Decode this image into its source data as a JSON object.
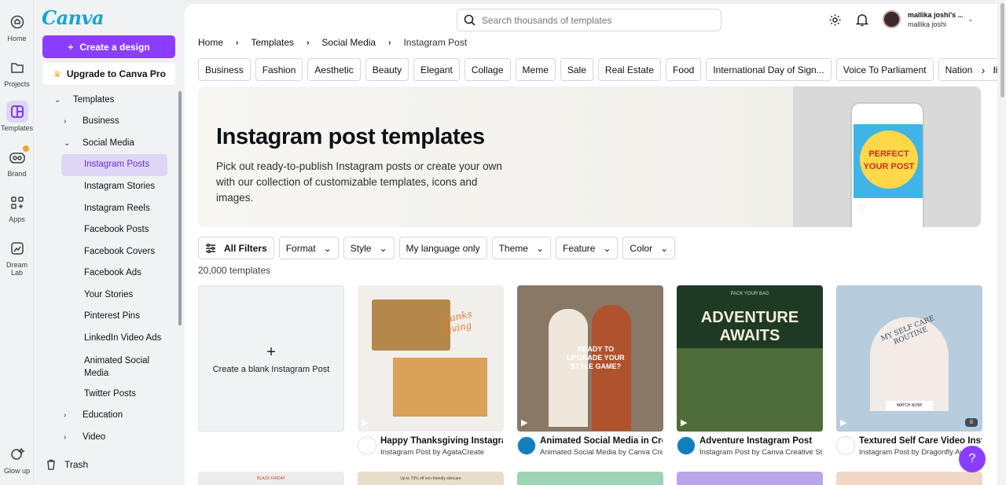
{
  "rail": [
    {
      "label": "Home",
      "icon": "home-icon"
    },
    {
      "label": "Projects",
      "icon": "folder-icon"
    },
    {
      "label": "Templates",
      "icon": "templates-icon"
    },
    {
      "label": "Brand",
      "icon": "brand-icon"
    },
    {
      "label": "Apps",
      "icon": "apps-icon"
    },
    {
      "label": "Dream Lab",
      "icon": "dream-lab-icon"
    },
    {
      "label": "Glow up",
      "icon": "glow-up-icon"
    }
  ],
  "panel": {
    "logo": "Canva",
    "create_label": "Create a design",
    "upgrade_label": "Upgrade to Canva Pro",
    "tree": {
      "templates": "Templates",
      "business": "Business",
      "social_media": "Social Media",
      "items": [
        "Instagram Posts",
        "Instagram Stories",
        "Instagram Reels",
        "Facebook Posts",
        "Facebook Covers",
        "Facebook Ads",
        "Your Stories",
        "Pinterest Pins",
        "LinkedIn Video Ads",
        "Animated Social Media",
        "Twitter Posts"
      ],
      "education": "Education",
      "video": "Video"
    },
    "trash_label": "Trash"
  },
  "header": {
    "search_placeholder": "Search thousands of templates",
    "user_name": "mallika joshi's ...",
    "user_sub": "mallika joshi"
  },
  "breadcrumbs": [
    "Home",
    "Templates",
    "Social Media",
    "Instagram Post"
  ],
  "chips": [
    "Business",
    "Fashion",
    "Aesthetic",
    "Beauty",
    "Elegant",
    "Collage",
    "Meme",
    "Sale",
    "Real Estate",
    "Food",
    "International Day of Sign...",
    "Voice To Parliament",
    "National Indigenous P"
  ],
  "banner": {
    "title": "Instagram post templates",
    "description": "Pick out ready-to-publish Instagram posts or create your own with our collection of customizable templates, icons and images.",
    "phone_line1": "PERFECT",
    "phone_line2": "YOUR POST"
  },
  "filters": {
    "all": "All Filters",
    "format": "Format",
    "style": "Style",
    "language": "My language only",
    "theme": "Theme",
    "feature": "Feature",
    "color": "Color"
  },
  "count": "20,000 templates",
  "blank_card": "Create a blank Instagram Post",
  "cards": [
    {
      "title": "Happy Thanksgiving Instagram Post",
      "sub": "Instagram Post by AgataCreate",
      "overlay": "thanks giving"
    },
    {
      "title": "Animated Social Media in Cream",
      "sub": "Animated Social Media by Canva Creative",
      "overlay": "READY TO UPGRADE YOUR STYLE GAME?"
    },
    {
      "title": "Adventure Instagram Post",
      "sub": "Instagram Post by Canva Creative Studio",
      "overlay": "ADVENTURE AWAITS",
      "overlay_top": "PACK YOUR BAG"
    },
    {
      "title": "Textured Self Care Video Instagram Post",
      "sub": "Instagram Post by Dragonfly Ave",
      "overlay": "MY SELF CARE ROUTINE",
      "overlay_btn": "WATCH NOW!"
    }
  ],
  "bottom_labels": {
    "black_friday": "BLACK FRIDAY",
    "skincare": "Up to 70% off eco-friendly skincare"
  },
  "colors": {
    "accent": "#8b3dff",
    "logo": "#17a6d2",
    "selected": "#ddd7f5"
  },
  "help_label": "?"
}
